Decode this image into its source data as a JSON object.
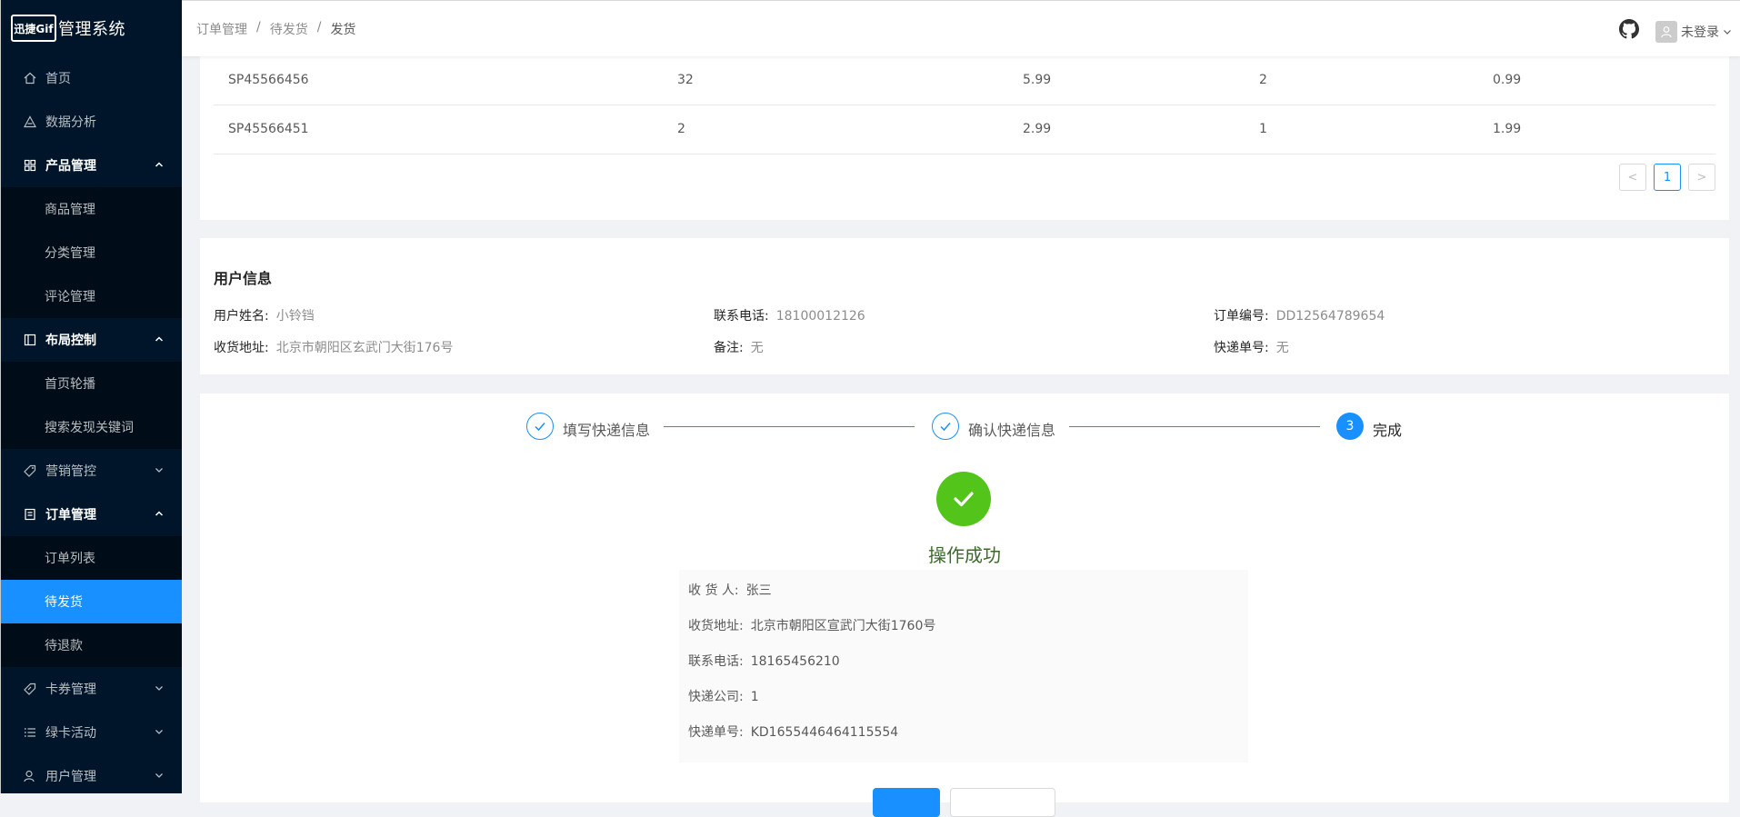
{
  "app": {
    "logo_text": "迅捷Gif",
    "title": "管理系统"
  },
  "sidebar": {
    "items": [
      {
        "label": "首页"
      },
      {
        "label": "数据分析"
      },
      {
        "label": "产品管理"
      },
      {
        "label": "商品管理"
      },
      {
        "label": "分类管理"
      },
      {
        "label": "评论管理"
      },
      {
        "label": "布局控制"
      },
      {
        "label": "首页轮播"
      },
      {
        "label": "搜索发现关键词"
      },
      {
        "label": "营销管控"
      },
      {
        "label": "订单管理"
      },
      {
        "label": "订单列表"
      },
      {
        "label": "待发货"
      },
      {
        "label": "待退款"
      },
      {
        "label": "卡券管理"
      },
      {
        "label": "绿卡活动"
      },
      {
        "label": "用户管理"
      }
    ]
  },
  "header": {
    "breadcrumb": [
      "订单管理",
      "待发货",
      "发货"
    ],
    "breadcrumb_sep": "/",
    "user_label": "未登录"
  },
  "table": {
    "rows": [
      [
        "SP45566456",
        "32",
        "5.99",
        "2",
        "0.99"
      ],
      [
        "SP45566451",
        "2",
        "2.99",
        "1",
        "1.99"
      ]
    ],
    "pagination": {
      "prev": "<",
      "current": "1",
      "next": ">"
    }
  },
  "user_info": {
    "title": "用户信息",
    "name_label": "用户姓名:",
    "name": "小铃铛",
    "phone_label": "联系电话:",
    "phone": "18100012126",
    "order_label": "订单编号:",
    "order_no": "DD12564789654",
    "address_label": "收货地址:",
    "address": "北京市朝阳区玄武门大街176号",
    "remark_label": "备注:",
    "remark": "无",
    "express_label": "快递单号:",
    "express_no": "无"
  },
  "steps": {
    "items": [
      {
        "title": "填写快递信息",
        "status": "done"
      },
      {
        "title": "确认快递信息",
        "status": "done"
      },
      {
        "title": "完成",
        "status": "current",
        "number": "3"
      }
    ]
  },
  "result": {
    "title": "操作成功",
    "receiver_label": "收 货 人:",
    "receiver": "张三",
    "address_label": "收货地址:",
    "address": "北京市朝阳区宣武门大街1760号",
    "phone_label": "联系电话:",
    "phone": "18165456210",
    "company_label": "快递公司:",
    "company": "1",
    "express_label": "快递单号:",
    "express_no": "KD1655446464115554"
  },
  "colors": {
    "sidebar_bg": "#001529",
    "submenu_bg": "#000c17",
    "accent": "#1890ff",
    "success": "#52c41a"
  }
}
